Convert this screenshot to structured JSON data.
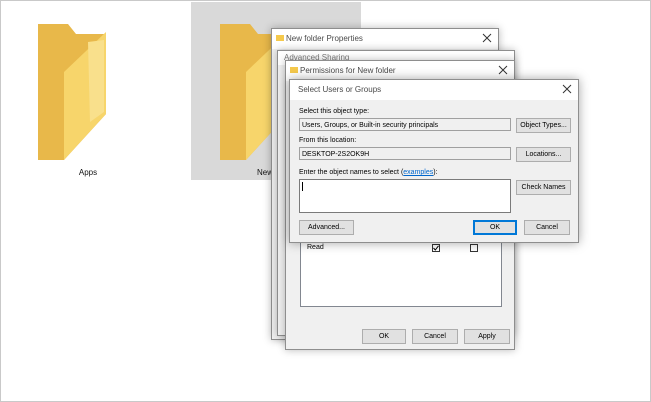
{
  "desktop": {
    "folders": [
      {
        "label": "Apps"
      },
      {
        "label": "New"
      }
    ]
  },
  "properties_window": {
    "title": "New folder Properties"
  },
  "advanced_sharing_window": {
    "title": "Advanced Sharing"
  },
  "permissions_window": {
    "title": "Permissions for New folder",
    "permission_row": {
      "label": "Read",
      "allow_checked": true,
      "deny_checked": false
    },
    "buttons": {
      "ok": "OK",
      "cancel": "Cancel",
      "apply": "Apply"
    }
  },
  "select_users_dialog": {
    "title": "Select Users or Groups",
    "object_type_label": "Select this object type:",
    "object_type_value": "Users, Groups, or Built-in security principals",
    "object_types_button": "Object Types...",
    "location_label": "From this location:",
    "location_value": "DESKTOP-2S2OK9H",
    "locations_button": "Locations...",
    "names_label": "Enter the object names to select (",
    "names_link": "examples",
    "names_label_end": "):",
    "names_value": "",
    "check_names_button": "Check Names",
    "advanced_button": "Advanced...",
    "ok_button": "OK",
    "cancel_button": "Cancel"
  },
  "colors": {
    "link": "#0066cc",
    "default_button_border": "#0078d7",
    "folder": "#f5c94c"
  }
}
